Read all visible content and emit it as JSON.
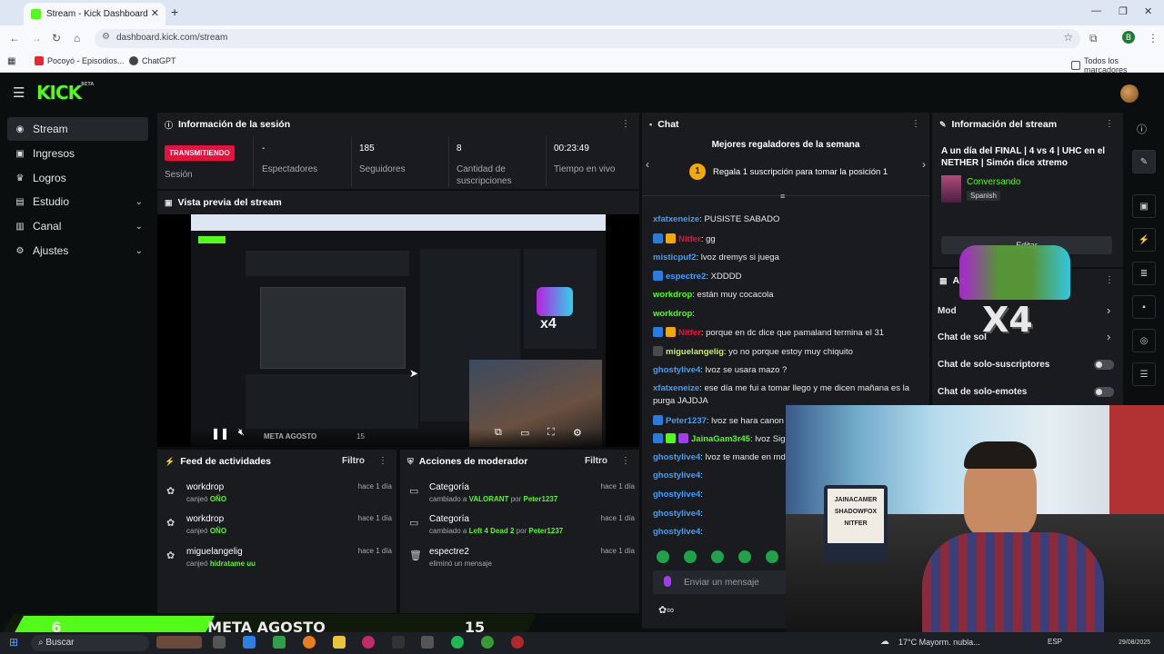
{
  "browser": {
    "tab_title": "Stream - Kick Dashboard",
    "url": "dashboard.kick.com/stream",
    "bookmarks": [
      "Pocoyó - Episodios...",
      "ChatGPT"
    ],
    "bookmarks_right": "Todos los marcadores",
    "profile_letter": "B"
  },
  "kick": {
    "logo": "KICK",
    "logo_tag": "BETA"
  },
  "sidebar": {
    "items": [
      {
        "label": "Stream",
        "icon": "stream-icon"
      },
      {
        "label": "Ingresos",
        "icon": "wallet-icon"
      },
      {
        "label": "Logros",
        "icon": "trophy-icon"
      },
      {
        "label": "Estudio",
        "icon": "studio-icon"
      },
      {
        "label": "Canal",
        "icon": "channel-icon"
      },
      {
        "label": "Ajustes",
        "icon": "gear-icon"
      }
    ]
  },
  "session": {
    "title": "Información de la sesión",
    "live_badge": "TRANSMITIENDO",
    "session_label": "Sesión",
    "stats": [
      {
        "value": "-",
        "label": "Espectadores"
      },
      {
        "value": "185",
        "label": "Seguidores"
      },
      {
        "value": "8",
        "label": "Cantidad de suscripciones"
      },
      {
        "value": "00:23:49",
        "label": "Tiempo en vivo"
      }
    ]
  },
  "preview": {
    "title": "Vista previa del stream",
    "overlay_text": "META AGOSTO",
    "overlay_right": "15",
    "overlay_mult": "x4"
  },
  "feed": {
    "title": "Feed de actividades",
    "filter": "Filtro",
    "items": [
      {
        "name": "workdrop",
        "action": "canjeó",
        "reward": "OÑO",
        "time": "hace 1 día"
      },
      {
        "name": "workdrop",
        "action": "canjeó",
        "reward": "OÑO",
        "time": "hace 1 día"
      },
      {
        "name": "miguelangelig",
        "action": "canjeó",
        "reward": "hidratame uu",
        "time": "hace 1 día"
      }
    ]
  },
  "mod": {
    "title": "Acciones de moderador",
    "filter": "Filtro",
    "items": [
      {
        "title": "Categoría",
        "pre": "cambiado a",
        "value": "VALORANT",
        "by": "por",
        "user": "Peter1237",
        "time": "hace 1 día"
      },
      {
        "title": "Categoría",
        "pre": "cambiado a",
        "value": "Left 4 Dead 2",
        "by": "por",
        "user": "Peter1237",
        "time": "hace 1 día"
      },
      {
        "title": "espectre2",
        "pre": "eliminó un mensaje",
        "value": "",
        "by": "",
        "user": "",
        "time": "hace 1 día"
      }
    ]
  },
  "chat": {
    "title": "Chat",
    "gifters_title": "Mejores regaladores de la semana",
    "gifters_rank": "1",
    "gifters_cta": "Regala 1 suscripción para tomar la posición 1",
    "input_placeholder": "Enviar un mensaje",
    "messages": [
      {
        "user": "xfatxeneize",
        "text": ": PUSISTE SABADO",
        "color": "#3aa1ff"
      },
      {
        "user": "Nitfer",
        "text": ": gg",
        "color": "#e9113c"
      },
      {
        "user": "misticpuf2",
        "text": ": lvoz dremys si juega",
        "color": "#3aa1ff"
      },
      {
        "user": "espectre2",
        "text": ": XDDDD",
        "color": "#3aa1ff"
      },
      {
        "user": "workdrop",
        "text": ": están muy cocacola",
        "color": "#53fc18"
      },
      {
        "user": "workdrop",
        "text": ":",
        "color": "#53fc18"
      },
      {
        "user": "Nitfer",
        "text": ": porque en dc dice que pamaland termina el 31",
        "color": "#e9113c"
      },
      {
        "user": "miguelangelig",
        "text": ": yo no porque estoy muy chiquito",
        "color": "#c7f23a"
      },
      {
        "user": "ghostylive4",
        "text": ": lvoz se usara mazo ?",
        "color": "#3aa1ff"
      },
      {
        "user": "xfatxeneize",
        "text": ": ese día me fui a tomar llego y me dicen mañana es la",
        "color": "#3aa1ff"
      },
      {
        "user": "",
        "text": "purga JAJDJA",
        "color": "#e8e8e8"
      },
      {
        "user": "Peter1237",
        "text": ": lvoz se hara canon e",
        "color": "#3aa1ff"
      },
      {
        "user": "JainaGam3r45",
        "text": ": lvoz Sig",
        "color": "#53fc18"
      },
      {
        "user": "ghostylive4",
        "text": ": lvoz te mande en md l",
        "color": "#3aa1ff"
      },
      {
        "user": "ghostylive4",
        "text": ":",
        "color": "#3aa1ff"
      },
      {
        "user": "ghostylive4",
        "text": ":",
        "color": "#3aa1ff"
      },
      {
        "user": "ghostylive4",
        "text": ":",
        "color": "#3aa1ff"
      },
      {
        "user": "ghostylive4",
        "text": ":",
        "color": "#3aa1ff"
      }
    ]
  },
  "streaminfo": {
    "title": "Información del stream",
    "stream_title": "A un día del FINAL | 4 vs 4 | UHC en el NETHER | Simón dice xtremo",
    "category": "Conversando",
    "language": "Spanish",
    "edit": "Editar",
    "section2": "Ac",
    "rows": [
      {
        "label": "Mod"
      },
      {
        "label": "Chat de sol"
      },
      {
        "label": "Chat de solo-suscriptores"
      },
      {
        "label": "Chat de solo-emotes"
      }
    ],
    "overlay_mult": "X4",
    "webcam_sign": [
      "JAINACAMER",
      "SHADOWFOX",
      "NITFER"
    ]
  },
  "overlay": {
    "left_num": "6",
    "label": "META AGOSTO",
    "right_num": "15"
  },
  "taskbar": {
    "search": "Buscar",
    "weather": "17°C  Mayorm. nubla...",
    "lang": "ESP",
    "date": "29/08/2025"
  },
  "colors": {
    "brand": "#53fc18",
    "live": "#e9113c",
    "panel": "#191b1f",
    "bg": "#0b0e0f"
  }
}
